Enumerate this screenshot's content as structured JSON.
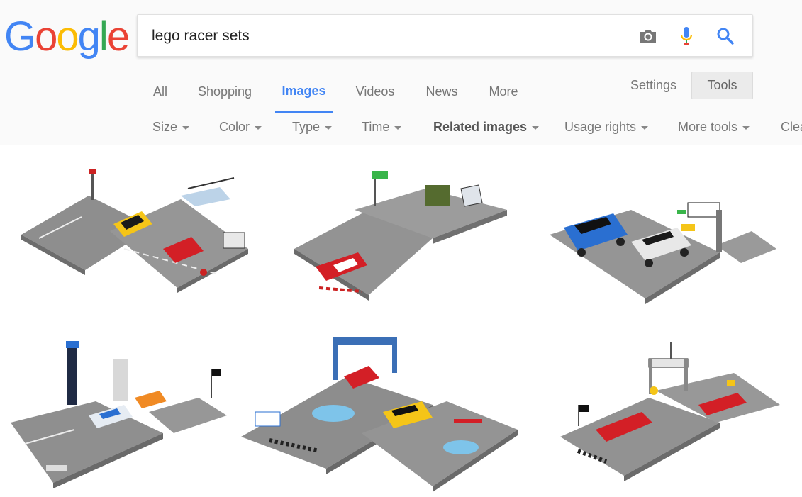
{
  "logo": {
    "letters": [
      "G",
      "o",
      "o",
      "g",
      "l",
      "e"
    ]
  },
  "search": {
    "query": "lego racer sets"
  },
  "icons": {
    "camera": "camera-icon",
    "mic": "microphone-icon",
    "search": "search-icon"
  },
  "tabs": [
    {
      "label": "All"
    },
    {
      "label": "Shopping"
    },
    {
      "label": "Images"
    },
    {
      "label": "Videos"
    },
    {
      "label": "News"
    },
    {
      "label": "More"
    }
  ],
  "settings_label": "Settings",
  "tools_label": "Tools",
  "toolbar": [
    {
      "label": "Size"
    },
    {
      "label": "Color"
    },
    {
      "label": "Type"
    },
    {
      "label": "Time"
    },
    {
      "label": "Related images"
    },
    {
      "label": "Usage rights"
    },
    {
      "label": "More tools"
    },
    {
      "label": "Clear"
    }
  ],
  "colors": {
    "accent": "#4285f4",
    "brick_gray": "#8a8a8a",
    "baseplate": "#9b9b9b",
    "car_yellow": "#f5c518",
    "car_red": "#d31f26",
    "car_blue": "#2a6fd1"
  },
  "images": [
    {
      "alt": "lego racer set 1"
    },
    {
      "alt": "lego racer set 2"
    },
    {
      "alt": "lego racer set 3"
    },
    {
      "alt": "lego racer set 4"
    },
    {
      "alt": "lego racer set 5"
    },
    {
      "alt": "lego racer set 6"
    }
  ]
}
